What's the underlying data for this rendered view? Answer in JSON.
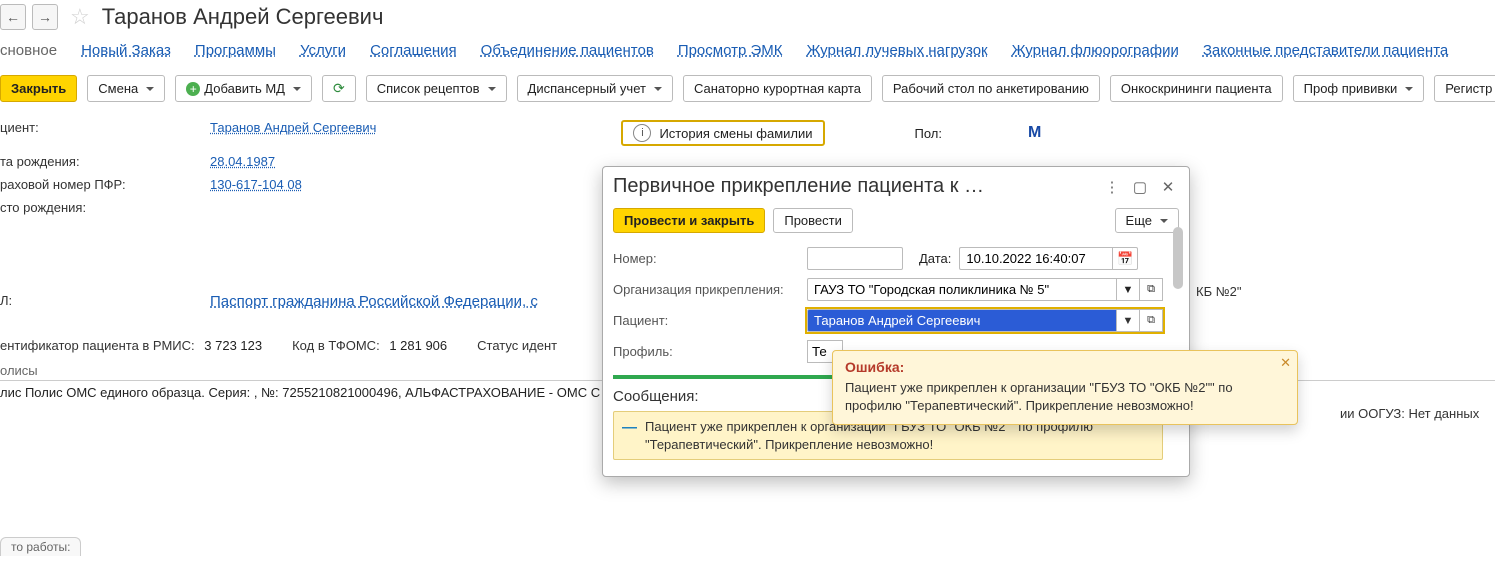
{
  "header": {
    "title": "Таранов Андрей Сергеевич"
  },
  "tabs": {
    "main": "сновное",
    "items": [
      "Новый Заказ",
      "Программы",
      "Услуги",
      "Соглашения",
      "Объединение пациентов",
      "Просмотр ЭМК",
      "Журнал лучевых нагрузок",
      "Журнал флюорографии",
      "Законные представители пациента"
    ]
  },
  "toolbar": {
    "close": "Закрыть",
    "change": "Смена",
    "add_md": "Добавить МД",
    "recipes": "Список рецептов",
    "disp": "Диспансерный учет",
    "sanat": "Санаторно курортная карта",
    "worktable": "Рабочий стол по анкетированию",
    "onco": "Онкоскрининги пациента",
    "vacc": "Проф прививки",
    "reg": "Регистр"
  },
  "info": {
    "patient_label": "циент:",
    "patient_name": "Таранов Андрей Сергеевич",
    "history_btn": "История смены фамилии",
    "gender_label": "Пол:",
    "gender_value": "М",
    "dob_label": "та рождения:",
    "dob_value": "28.04.1987",
    "snils_label": "раховой номер ПФР:",
    "snils_value": "130-617-104 08",
    "pob_label": "сто рождения:",
    "ul_label": "Л:",
    "ul_value": "Паспорт гражданина Российской Федерации, с",
    "rmis_label": "ентификатор пациента в РМИС:",
    "rmis_value": "3 723 123",
    "tfoms_label": "Код в ТФОМС:",
    "tfoms_value": "1 281 906",
    "status_label": "Статус идент",
    "ooguz_label": "ии ООГУЗ:",
    "ooguz_value": "Нет данных"
  },
  "sections": {
    "policies": "олисы",
    "policy_row": "лис Полис ОМС единого образца. Серия: , №: 7255210821000496, АЛЬФАСТРАХОВАНИЕ - ОМС С"
  },
  "bottom_tab": "то работы:",
  "right_hint": "КБ №2\"",
  "modal": {
    "title": "Первичное прикрепление пациента к …",
    "submit_close": "Провести и закрыть",
    "submit": "Провести",
    "more": "Еще",
    "num_label": "Номер:",
    "date_label": "Дата:",
    "date_value": "10.10.2022 16:40:07",
    "org_label": "Организация прикрепления:",
    "org_value": "ГАУЗ ТО \"Городская поликлиника № 5\"",
    "patient_label": "Пациент:",
    "patient_value": "Таранов Андрей Сергеевич",
    "profile_label": "Профиль:",
    "profile_value": "Те",
    "messages_title": "Сообщения:",
    "msg_text": "Пациент уже прикреплен к организации \"ГБУЗ ТО \"ОКБ №2\"\" по профилю \"Терапевтический\". Прикрепление невозможно!"
  },
  "tooltip": {
    "title": "Ошибка:",
    "body": "Пациент уже прикреплен к организации \"ГБУЗ ТО \"ОКБ №2\"\" по профилю \"Терапевтический\". Прикрепление невозможно!"
  }
}
